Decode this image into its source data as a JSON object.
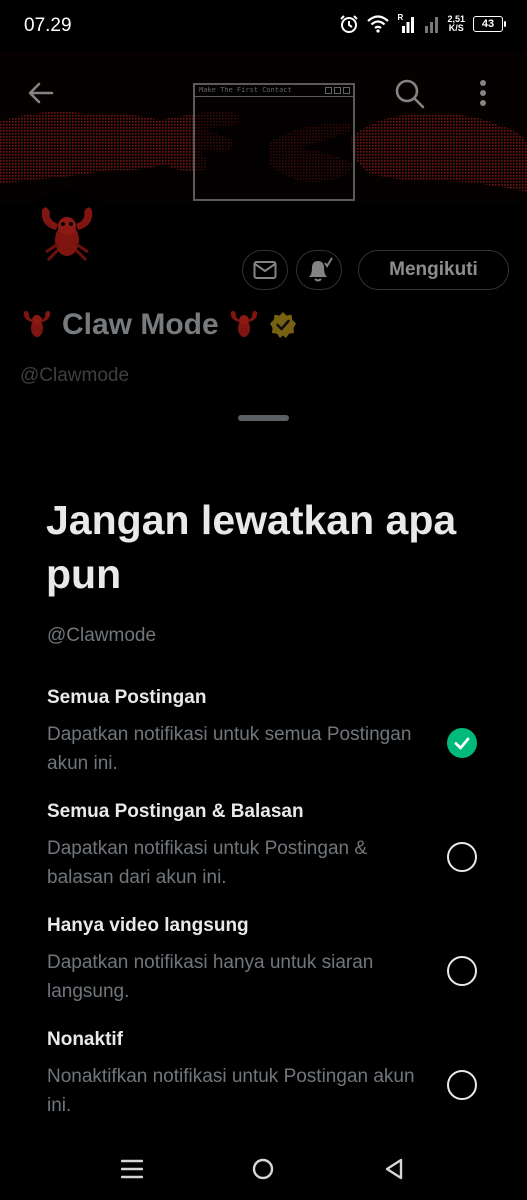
{
  "status_bar": {
    "time": "07.29",
    "net_speed_value": "2,51",
    "net_speed_unit": "K/S",
    "signal_label": "R",
    "battery": "43"
  },
  "banner": {
    "window_title": "Make The First Contact"
  },
  "profile": {
    "display_name": "Claw Mode",
    "handle": "@Clawmode",
    "follow_label": "Mengikuti"
  },
  "sheet": {
    "title": "Jangan lewatkan apa pun",
    "handle": "@Clawmode",
    "options": [
      {
        "title": "Semua Postingan",
        "description": "Dapatkan notifikasi untuk semua Postingan akun ini.",
        "selected": true
      },
      {
        "title": "Semua Postingan & Balasan",
        "description": "Dapatkan notifikasi untuk Postingan & balasan dari akun ini.",
        "selected": false
      },
      {
        "title": "Hanya video langsung",
        "description": "Dapatkan notifikasi hanya untuk siaran langsung.",
        "selected": false
      },
      {
        "title": "Nonaktif",
        "description": "Nonaktifkan notifikasi untuk Postingan akun ini.",
        "selected": false
      }
    ]
  },
  "colors": {
    "accent_green": "#00ba7c",
    "verified_gold": "#e2b719",
    "lobster_red": "#d0271d"
  }
}
